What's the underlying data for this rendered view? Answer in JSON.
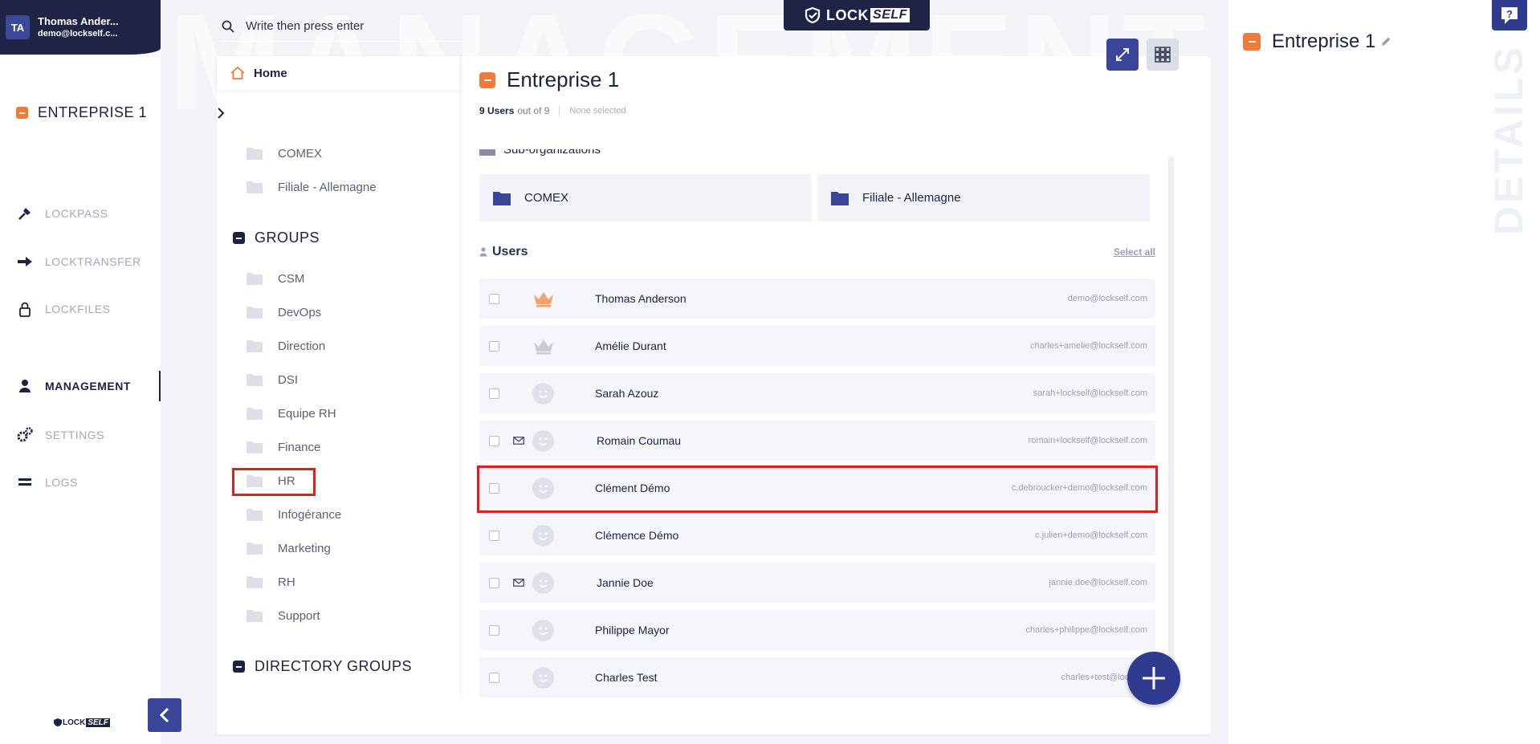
{
  "user": {
    "initials": "TA",
    "name": "Thomas Ander...",
    "email": "demo@lockself.c..."
  },
  "nav": {
    "items": [
      {
        "label": "LOCKPASS",
        "icon": "key-icon"
      },
      {
        "label": "LOCKTRANSFER",
        "icon": "arrow-right-icon"
      },
      {
        "label": "LOCKFILES",
        "icon": "lock-icon"
      },
      {
        "label": "MANAGEMENT",
        "icon": "user-icon"
      },
      {
        "label": "SETTINGS",
        "icon": "gears-icon"
      },
      {
        "label": "LOGS",
        "icon": "list-icon"
      }
    ],
    "active": "MANAGEMENT"
  },
  "brand": {
    "lock": "LOCK",
    "self": "SELF"
  },
  "watermark": "MANAGEMENT",
  "search": {
    "placeholder": "Write then press enter"
  },
  "tree": {
    "home": "Home",
    "org_title": "ENTREPRISE 1",
    "org_children": [
      "COMEX",
      "Filiale - Allemagne"
    ],
    "groups_title": "GROUPS",
    "groups": [
      "CSM",
      "DevOps",
      "Direction",
      "DSI",
      "Equipe RH",
      "Finance",
      "HR",
      "Infogérance",
      "Marketing",
      "RH",
      "Support"
    ],
    "directory_title": "DIRECTORY GROUPS"
  },
  "content": {
    "title": "Entreprise 1",
    "count_bold": "9 Users",
    "count_rest": "out of 9",
    "selection": "None selected",
    "suborg_heading": "Sub-organizations",
    "suborgs": [
      "COMEX",
      "Filiale - Allemagne"
    ],
    "users_heading": "Users",
    "select_all": "Select all",
    "users": [
      {
        "name": "Thomas Anderson",
        "email": "demo@lockself.com",
        "icon": "crown-orange",
        "mail": false
      },
      {
        "name": "Amélie Durant",
        "email": "charles+amelie@lockself.com",
        "icon": "crown-grey",
        "mail": false
      },
      {
        "name": "Sarah Azouz",
        "email": "sarah+lockself@lockself.com",
        "icon": "face",
        "mail": false
      },
      {
        "name": "Romain Coumau",
        "email": "romain+lockself@lockself.com",
        "icon": "face",
        "mail": true
      },
      {
        "name": "Clément Démo",
        "email": "c.debroucker+demo@lockself.com",
        "icon": "face",
        "mail": false
      },
      {
        "name": "Clémence Démo",
        "email": "c.julien+demo@lockself.com",
        "icon": "face",
        "mail": false
      },
      {
        "name": "Jannie Doe",
        "email": "jannie.doe@lockself.com",
        "icon": "face",
        "mail": true
      },
      {
        "name": "Philippe Mayor",
        "email": "charles+philippe@lockself.com",
        "icon": "face",
        "mail": false
      },
      {
        "name": "Charles Test",
        "email": "charles+test@lockself",
        "icon": "face",
        "mail": false
      }
    ]
  },
  "details": {
    "title": "Entreprise 1",
    "vertical_label": "DETAILS"
  },
  "colors": {
    "navy": "#1f2346",
    "accent": "#3a4699",
    "orange": "#f07a3a",
    "highlight": "#e02020"
  }
}
